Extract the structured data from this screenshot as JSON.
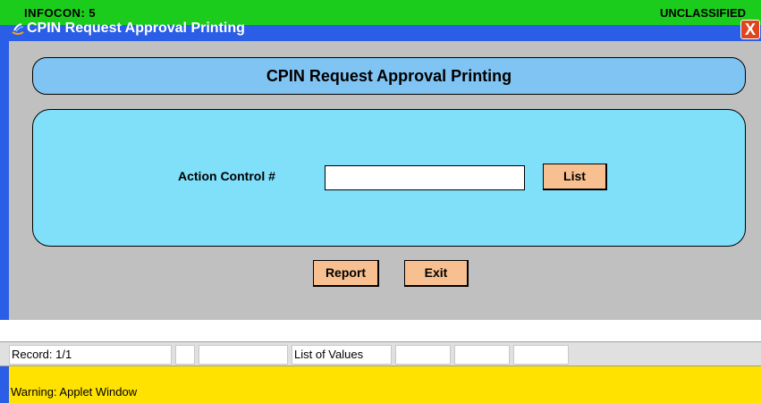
{
  "banner": {
    "infocon": "INFOCON: 5",
    "classification": "UNCLASSIFIED",
    "color": "#1ccc1c"
  },
  "window": {
    "title": "CPIN Request Approval Printing",
    "close_label": "X",
    "icon": "java-cup-icon",
    "title_bar_color": "#2a5ee6"
  },
  "form": {
    "title": "CPIN Request Approval Printing",
    "field_label": "Action Control #",
    "field_value": "",
    "list_button": "List",
    "report_button": "Report",
    "exit_button": "Exit",
    "panel_color": "#80e0fa",
    "title_color": "#80c4f4",
    "button_color": "#f8c090"
  },
  "status": {
    "record": "Record: 1/1",
    "cell2": "",
    "cell3": "",
    "list_of_values": "List of Values",
    "cell5": "",
    "cell6": "",
    "cell7": ""
  },
  "warning": {
    "text": "Warning: Applet Window",
    "color": "#ffe200"
  }
}
